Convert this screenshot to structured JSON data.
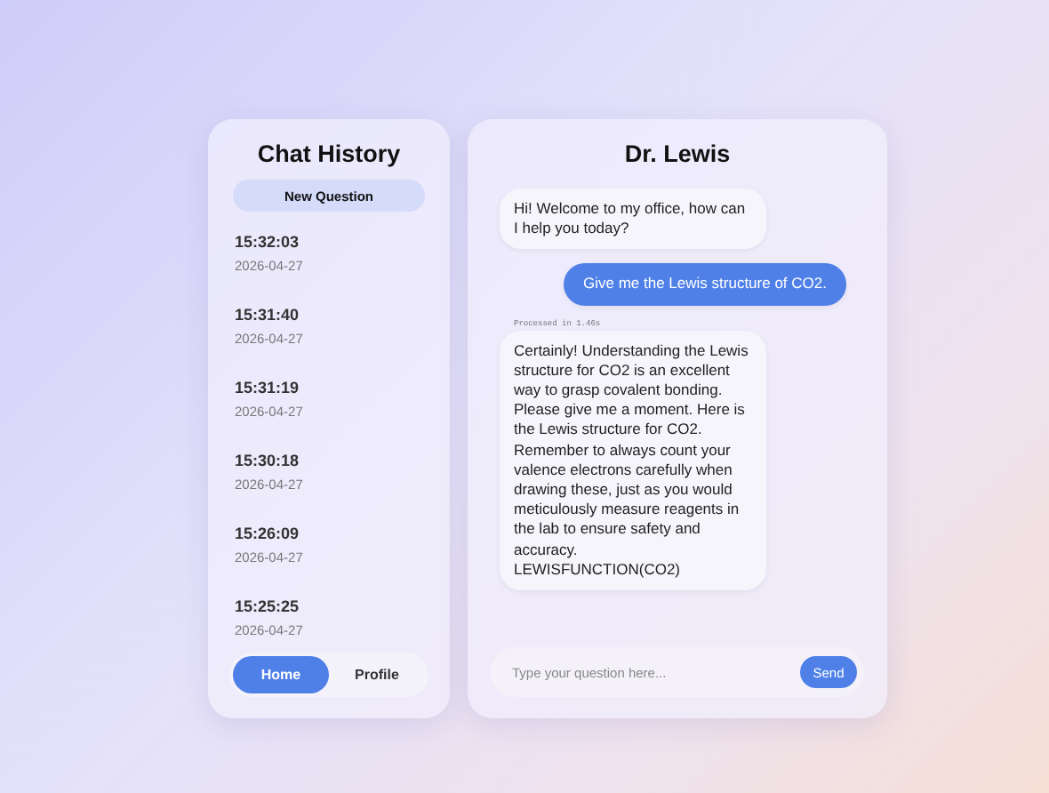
{
  "sidebar": {
    "title": "Chat History",
    "new_button": "New Question",
    "items": [
      {
        "time": "15:32:03",
        "date": "2026-04-27"
      },
      {
        "time": "15:31:40",
        "date": "2026-04-27"
      },
      {
        "time": "15:31:19",
        "date": "2026-04-27"
      },
      {
        "time": "15:30:18",
        "date": "2026-04-27"
      },
      {
        "time": "15:26:09",
        "date": "2026-04-27"
      },
      {
        "time": "15:25:25",
        "date": "2026-04-27"
      }
    ],
    "nav": [
      {
        "label": "Home",
        "selected": true
      },
      {
        "label": "Profile",
        "selected": false
      }
    ]
  },
  "chat": {
    "title": "Dr. Lewis",
    "messages": [
      {
        "kind": "bot",
        "text": "Hi! Welcome to my office, how can I help you today?"
      },
      {
        "kind": "user",
        "text": "Give me the Lewis structure of CO2."
      },
      {
        "kind": "bot",
        "note": "Processed in 1.46s",
        "text": "Certainly! Understanding the Lewis structure for CO2 is an excellent way to grasp covalent bonding. Please give me a moment. Here is the Lewis structure for CO2. Remember to always count your valence electrons carefully when drawing these, just as you would meticulously measure reagents in the lab to ensure safety and accuracy.\nLEWISFUNCTION(CO2)"
      }
    ],
    "input": {
      "placeholder": "Type your question here..."
    },
    "send": "Send"
  }
}
